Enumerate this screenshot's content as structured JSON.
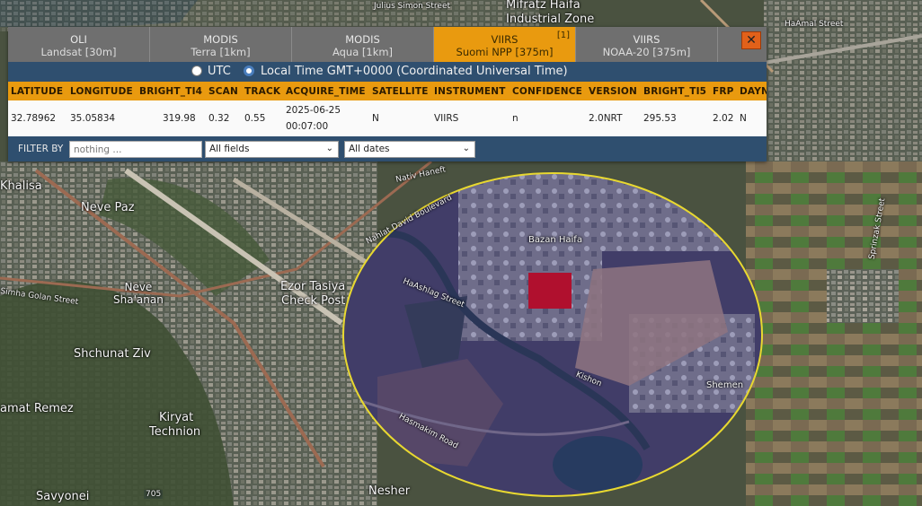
{
  "tabs": [
    {
      "title": "OLI",
      "subtitle": "Landsat [30m]",
      "badge": ""
    },
    {
      "title": "MODIS",
      "subtitle": "Terra [1km]",
      "badge": ""
    },
    {
      "title": "MODIS",
      "subtitle": "Aqua [1km]",
      "badge": ""
    },
    {
      "title": "VIIRS",
      "subtitle": "Suomi NPP [375m]",
      "badge": "[1]"
    },
    {
      "title": "VIIRS",
      "subtitle": "NOAA-20 [375m]",
      "badge": ""
    }
  ],
  "close_label": "✕",
  "timezone": {
    "utc_label": "UTC",
    "local_label": "Local Time GMT+0000 (Coordinated Universal Time)",
    "selected": "local"
  },
  "columns": [
    "LATITUDE",
    "LONGITUDE",
    "BRIGHT_TI4",
    "SCAN",
    "TRACK",
    "ACQUIRE_TIME",
    "SATELLITE",
    "INSTRUMENT",
    "CONFIDENCE",
    "VERSION",
    "BRIGHT_TI5",
    "FRP",
    "DAYN"
  ],
  "rows": [
    {
      "latitude": "32.78962",
      "longitude": "35.05834",
      "bright_ti4": "319.98",
      "scan": "0.32",
      "track": "0.55",
      "acquire_date": "2025-06-25",
      "acquire_time": "00:07:00",
      "satellite": "N",
      "instrument": "VIIRS",
      "confidence": "n",
      "version": "2.0NRT",
      "bright_ti5": "295.53",
      "frp": "2.02",
      "daynight": "N"
    }
  ],
  "filter": {
    "label": "FILTER BY",
    "placeholder": "nothing ...",
    "field_select": "All fields",
    "date_select": "All dates"
  },
  "map_labels": {
    "mifratz": "Mifratz Haifa",
    "industrial_zone": "Industrial Zone",
    "julius_simon": "Julius Simon Street",
    "haamal": "HaAmal Street",
    "khalisa": "Khalisa",
    "neve_paz": "Neve Paz",
    "neve_shaanan": "Neve\nSha'anan",
    "ezor_tasiya": "Ezor Tasiya",
    "check_post": "Check Post",
    "shchunat_ziv": "Shchunat Ziv",
    "ramat_remez": "amat Remez",
    "kiryat": "Kiryat",
    "technion": "Technion",
    "savyonei": "Savyonei",
    "nesher": "Nesher",
    "bazan": "Bazan Haifa",
    "shemen": "Shemen",
    "nativ_haneft": "Nativ Haneft",
    "nahlat": "Nahlat David Boulevard",
    "haashlag": "HaAshlag Street",
    "hasmakim": "Hasmakim Road",
    "kishon": "Kishon",
    "sprinzak": "Sprinzak Street",
    "simha": "Simha Golan Street",
    "road_705": "705"
  },
  "colors": {
    "tab_active": "#e99a0f",
    "header_bg": "#2f4f6f",
    "fire_pixel": "#b0102e",
    "circle": "#e8d830"
  }
}
